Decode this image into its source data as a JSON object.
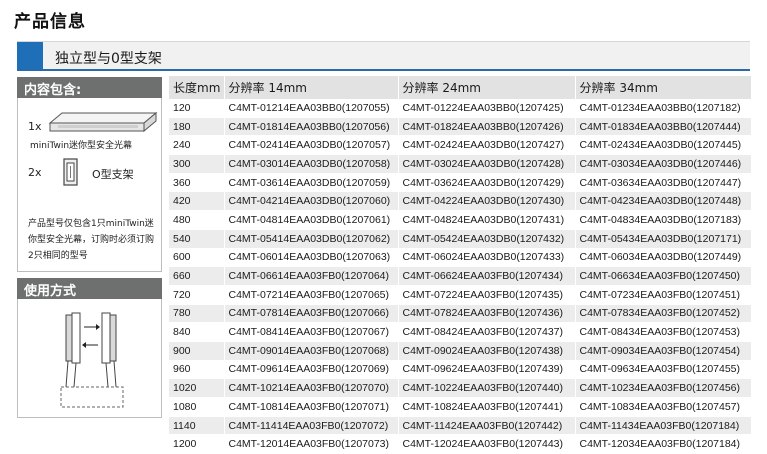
{
  "page_title": "产品信息",
  "section_title": "独立型与0型支架",
  "contents": {
    "heading": "内容包含:",
    "item1_qty": "1x",
    "item1_caption": "miniTwin迷你型安全光幕",
    "item2_qty": "2x",
    "item2_caption": "O型支架",
    "note": "产品型号仅包含1只miniTwin迷你型安全光幕，订购时必须订购2只相同的型号"
  },
  "usage": {
    "heading": "使用方式"
  },
  "table": {
    "headers": [
      "长度mm",
      "分辨率 14mm",
      "分辨率 24mm",
      "分辨率 34mm"
    ],
    "rows": [
      [
        "120",
        "C4MT-01214EAA03BB0(1207055)",
        "C4MT-01224EAA03BB0(1207425)",
        "C4MT-01234EAA03BB0(1207182)"
      ],
      [
        "180",
        "C4MT-01814EAA03BB0(1207056)",
        "C4MT-01824EAA03BB0(1207426)",
        "C4MT-01834EAA03BB0(1207444)"
      ],
      [
        "240",
        "C4MT-02414EAA03DB0(1207057)",
        "C4MT-02424EAA03DB0(1207427)",
        "C4MT-02434EAA03DB0(1207445)"
      ],
      [
        "300",
        "C4MT-03014EAA03DB0(1207058)",
        "C4MT-03024EAA03DB0(1207428)",
        "C4MT-03034EAA03DB0(1207446)"
      ],
      [
        "360",
        "C4MT-03614EAA03DB0(1207059)",
        "C4MT-03624EAA03DB0(1207429)",
        "C4MT-03634EAA03DB0(1207447)"
      ],
      [
        "420",
        "C4MT-04214EAA03DB0(1207060)",
        "C4MT-04224EAA03DB0(1207430)",
        "C4MT-04234EAA03DB0(1207448)"
      ],
      [
        "480",
        "C4MT-04814EAA03DB0(1207061)",
        "C4MT-04824EAA03DB0(1207431)",
        "C4MT-04834EAA03DB0(1207183)"
      ],
      [
        "540",
        "C4MT-05414EAA03DB0(1207062)",
        "C4MT-05424EAA03DB0(1207432)",
        "C4MT-05434EAA03DB0(1207171)"
      ],
      [
        "600",
        "C4MT-06014EAA03DB0(1207063)",
        "C4MT-06024EAA03DB0(1207433)",
        "C4MT-06034EAA03DB0(1207449)"
      ],
      [
        "660",
        "C4MT-06614EAA03FB0(1207064)",
        "C4MT-06624EAA03FB0(1207434)",
        "C4MT-06634EAA03FB0(1207450)"
      ],
      [
        "720",
        "C4MT-07214EAA03FB0(1207065)",
        "C4MT-07224EAA03FB0(1207435)",
        "C4MT-07234EAA03FB0(1207451)"
      ],
      [
        "780",
        "C4MT-07814EAA03FB0(1207066)",
        "C4MT-07824EAA03FB0(1207436)",
        "C4MT-07834EAA03FB0(1207452)"
      ],
      [
        "840",
        "C4MT-08414EAA03FB0(1207067)",
        "C4MT-08424EAA03FB0(1207437)",
        "C4MT-08434EAA03FB0(1207453)"
      ],
      [
        "900",
        "C4MT-09014EAA03FB0(1207068)",
        "C4MT-09024EAA03FB0(1207438)",
        "C4MT-09034EAA03FB0(1207454)"
      ],
      [
        "960",
        "C4MT-09614EAA03FB0(1207069)",
        "C4MT-09624EAA03FB0(1207439)",
        "C4MT-09634EAA03FB0(1207455)"
      ],
      [
        "1020",
        "C4MT-10214EAA03FB0(1207070)",
        "C4MT-10224EAA03FB0(1207440)",
        "C4MT-10234EAA03FB0(1207456)"
      ],
      [
        "1080",
        "C4MT-10814EAA03FB0(1207071)",
        "C4MT-10824EAA03FB0(1207441)",
        "C4MT-10834EAA03FB0(1207457)"
      ],
      [
        "1140",
        "C4MT-11414EAA03FB0(1207072)",
        "C4MT-11424EAA03FB0(1207442)",
        "C4MT-11434EAA03FB0(1207184)"
      ],
      [
        "1200",
        "C4MT-12014EAA03FB0(1207073)",
        "C4MT-12024EAA03FB0(1207443)",
        "C4MT-12034EAA03FB0(1207184)"
      ]
    ]
  }
}
